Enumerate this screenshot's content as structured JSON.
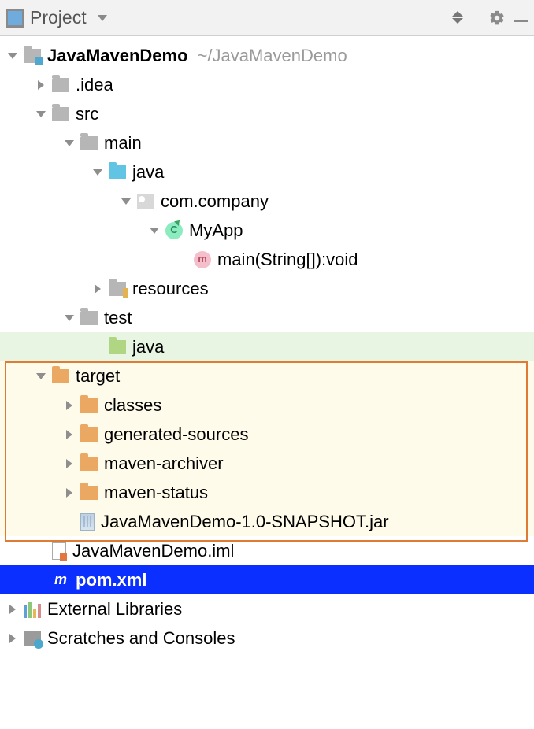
{
  "header": {
    "title": "Project"
  },
  "tree": {
    "root": {
      "name": "JavaMavenDemo",
      "path": "~/JavaMavenDemo"
    },
    "idea": ".idea",
    "src": "src",
    "main": "main",
    "java1": "java",
    "package": "com.company",
    "class": "MyApp",
    "method": "main(String[]):void",
    "resources": "resources",
    "test": "test",
    "java2": "java",
    "target": "target",
    "classes": "classes",
    "gensrc": "generated-sources",
    "archiver": "maven-archiver",
    "status": "maven-status",
    "jar": "JavaMavenDemo-1.0-SNAPSHOT.jar",
    "iml": "JavaMavenDemo.iml",
    "pom": "pom.xml",
    "extlib": "External Libraries",
    "scratches": "Scratches and Consoles"
  }
}
